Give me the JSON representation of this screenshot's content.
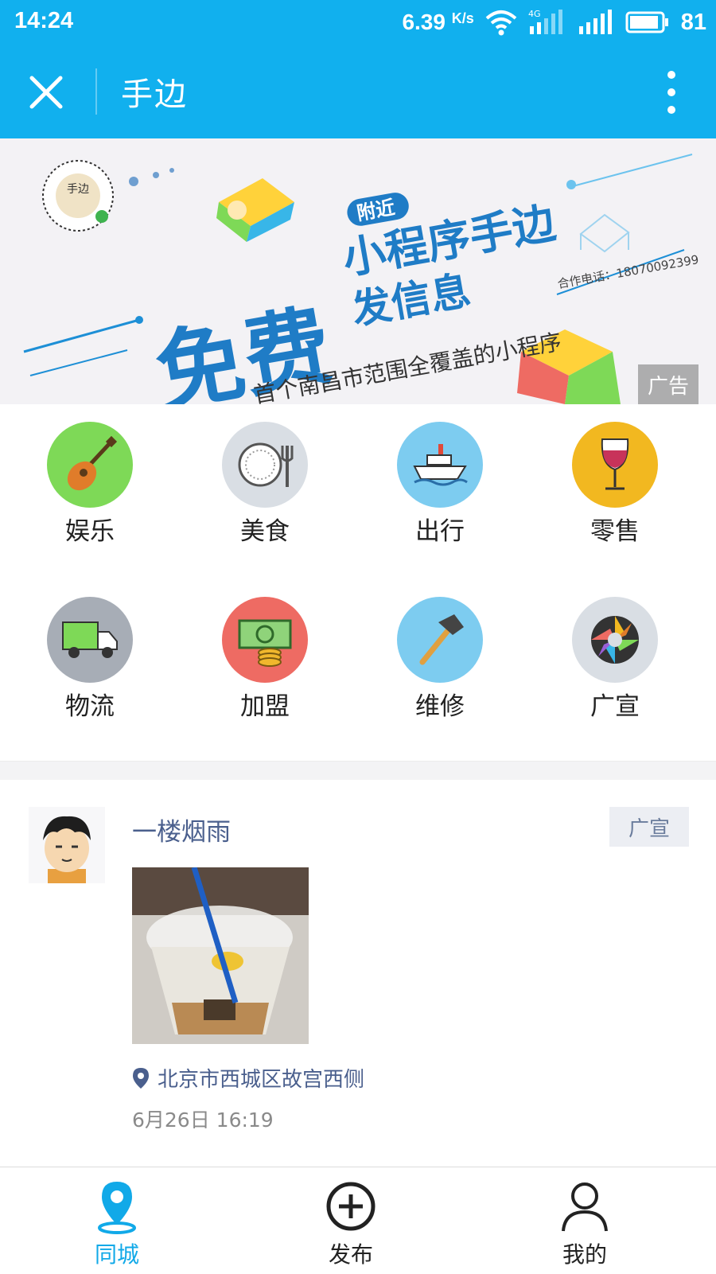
{
  "status_bar": {
    "time": "14:24",
    "net_speed_value": "6.39",
    "net_speed_unit": "K/s",
    "network_type": "4G",
    "battery_percent": "81"
  },
  "title_bar": {
    "title": "手边"
  },
  "banner": {
    "qr_text": "手边",
    "headline_free": "免费",
    "tag_nearby": "附近",
    "headline_app": "小程序手边",
    "headline_post": "发信息",
    "slogan": "首个南昌市范围全覆盖的小程序",
    "contact": "合作电话：18070092399",
    "ad_label": "广告"
  },
  "categories": [
    {
      "label": "娱乐",
      "icon": "guitar-icon",
      "color": "#7ed957"
    },
    {
      "label": "美食",
      "icon": "plate-fork-icon",
      "color": "#d9dee4"
    },
    {
      "label": "出行",
      "icon": "ship-icon",
      "color": "#7dccf0"
    },
    {
      "label": "零售",
      "icon": "wine-glass-icon",
      "color": "#f2b820"
    },
    {
      "label": "物流",
      "icon": "truck-icon",
      "color": "#a7adb6"
    },
    {
      "label": "加盟",
      "icon": "money-icon",
      "color": "#ee6b63"
    },
    {
      "label": "维修",
      "icon": "hammer-icon",
      "color": "#7dccf0"
    },
    {
      "label": "广宣",
      "icon": "aperture-icon",
      "color": "#d9dee4"
    }
  ],
  "post": {
    "username": "一楼烟雨",
    "tag": "广宣",
    "location": "北京市西城区故宫西侧",
    "time": "6月26日 16:19"
  },
  "bottom_nav": [
    {
      "label": "同城",
      "icon": "location-pin-icon",
      "active": true
    },
    {
      "label": "发布",
      "icon": "add-circle-icon",
      "active": false
    },
    {
      "label": "我的",
      "icon": "person-icon",
      "active": false
    }
  ],
  "colors": {
    "brand": "#11b0ee",
    "active_nav": "#11a9e8",
    "link_text": "#4a5f8d"
  }
}
